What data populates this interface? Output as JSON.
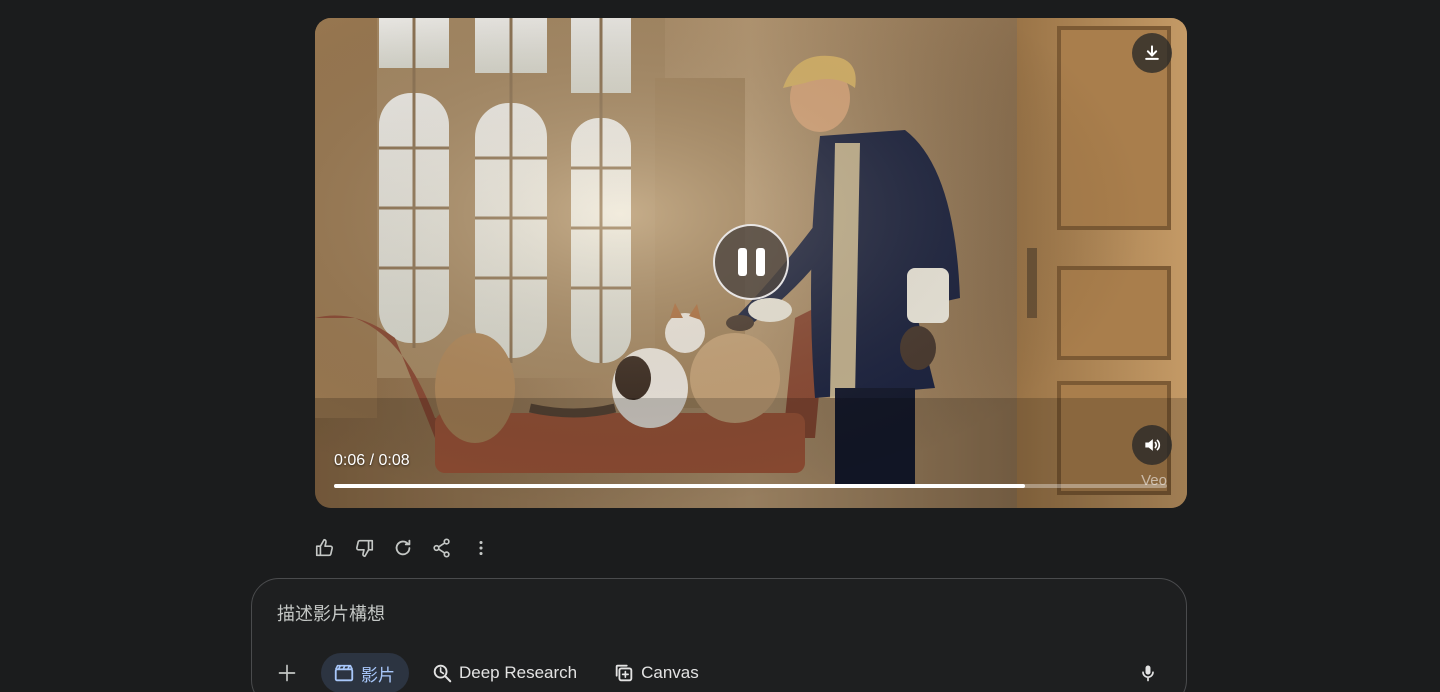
{
  "video": {
    "time_display": "0:06 / 0:08",
    "current_seconds": 6,
    "total_seconds": 8,
    "progress_fraction": 0.83,
    "watermark": "Veo",
    "state": "playing",
    "icons": {
      "download": "download-icon",
      "pause": "pause-icon",
      "volume": "volume-icon"
    }
  },
  "response_actions": [
    {
      "name": "thumbs-up",
      "icon": "thumbs-up-icon"
    },
    {
      "name": "thumbs-down",
      "icon": "thumbs-down-icon"
    },
    {
      "name": "regenerate",
      "icon": "refresh-icon"
    },
    {
      "name": "share",
      "icon": "share-icon"
    },
    {
      "name": "more",
      "icon": "more-vertical-icon"
    }
  ],
  "prompt": {
    "placeholder": "描述影片構想",
    "value": ""
  },
  "toolbar": {
    "video_label": "影片",
    "deep_research_label": "Deep Research",
    "canvas_label": "Canvas"
  },
  "colors": {
    "background": "#1b1c1d",
    "accent": "#a8c7fa",
    "active_chip": "#2c3441"
  }
}
